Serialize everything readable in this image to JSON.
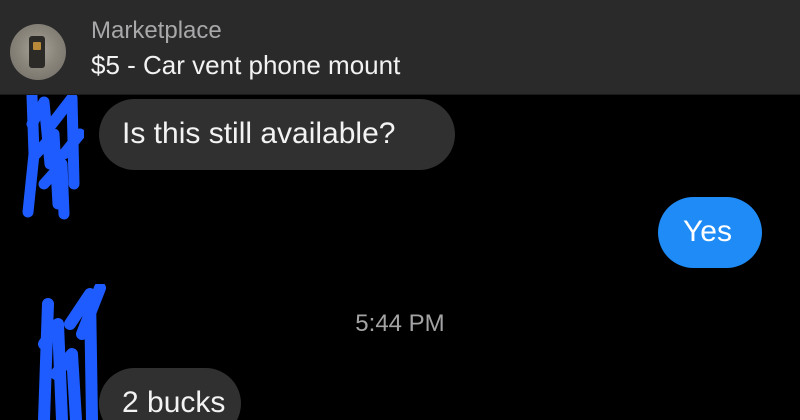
{
  "header": {
    "label": "Marketplace",
    "title": "$5 - Car vent phone mount",
    "thumbnail_icon": "product-thumbnail"
  },
  "messages": [
    {
      "direction": "incoming",
      "text": "Is this still available?"
    },
    {
      "direction": "outgoing",
      "text": "Yes"
    },
    {
      "direction": "incoming",
      "text": "2 bucks"
    }
  ],
  "timestamp": "5:44 PM",
  "colors": {
    "background": "#000000",
    "header_bg": "#2a2a2b",
    "incoming_bubble": "#303031",
    "outgoing_bubble": "#1f8bf6",
    "scribble": "#1e5cff"
  }
}
